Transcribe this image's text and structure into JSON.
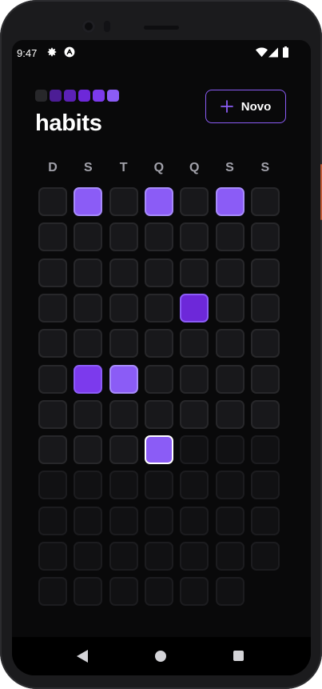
{
  "status_bar": {
    "time": "9:47",
    "icons": [
      "gear-icon",
      "app-notification-icon",
      "wifi-icon",
      "signal-icon",
      "battery-icon"
    ]
  },
  "header": {
    "title": "habits",
    "new_button_label": "Novo",
    "new_button_icon": "plus-icon"
  },
  "summary_levels": [
    0,
    1,
    2,
    3,
    4,
    5
  ],
  "weekdays": [
    "D",
    "S",
    "T",
    "Q",
    "Q",
    "S",
    "S"
  ],
  "colors": {
    "accent": "#8b5cf6",
    "background": "#09090a",
    "cell_empty": "#18181b",
    "level_1": "#4c1d95",
    "level_2": "#5b21b6",
    "level_3": "#6d28d9",
    "level_4": "#7c3aed",
    "level_5": "#8b5cf6"
  },
  "habit_grid": {
    "columns": 7,
    "days": [
      {
        "state": "past",
        "level": 0
      },
      {
        "state": "past",
        "level": 5
      },
      {
        "state": "past",
        "level": 0
      },
      {
        "state": "past",
        "level": 5
      },
      {
        "state": "past",
        "level": 0
      },
      {
        "state": "past",
        "level": 5
      },
      {
        "state": "past",
        "level": 0
      },
      {
        "state": "past",
        "level": 0
      },
      {
        "state": "past",
        "level": 0
      },
      {
        "state": "past",
        "level": 0
      },
      {
        "state": "past",
        "level": 0
      },
      {
        "state": "past",
        "level": 0
      },
      {
        "state": "past",
        "level": 0
      },
      {
        "state": "past",
        "level": 0
      },
      {
        "state": "past",
        "level": 0
      },
      {
        "state": "past",
        "level": 0
      },
      {
        "state": "past",
        "level": 0
      },
      {
        "state": "past",
        "level": 0
      },
      {
        "state": "past",
        "level": 0
      },
      {
        "state": "past",
        "level": 0
      },
      {
        "state": "past",
        "level": 0
      },
      {
        "state": "past",
        "level": 0
      },
      {
        "state": "past",
        "level": 0
      },
      {
        "state": "past",
        "level": 0
      },
      {
        "state": "past",
        "level": 0
      },
      {
        "state": "past",
        "level": 3
      },
      {
        "state": "past",
        "level": 0
      },
      {
        "state": "past",
        "level": 0
      },
      {
        "state": "past",
        "level": 0
      },
      {
        "state": "past",
        "level": 0
      },
      {
        "state": "past",
        "level": 0
      },
      {
        "state": "past",
        "level": 0
      },
      {
        "state": "past",
        "level": 0
      },
      {
        "state": "past",
        "level": 0
      },
      {
        "state": "past",
        "level": 0
      },
      {
        "state": "past",
        "level": 0
      },
      {
        "state": "past",
        "level": 4
      },
      {
        "state": "past",
        "level": 5
      },
      {
        "state": "past",
        "level": 0
      },
      {
        "state": "past",
        "level": 0
      },
      {
        "state": "past",
        "level": 0
      },
      {
        "state": "past",
        "level": 0
      },
      {
        "state": "past",
        "level": 0
      },
      {
        "state": "past",
        "level": 0
      },
      {
        "state": "past",
        "level": 0
      },
      {
        "state": "past",
        "level": 0
      },
      {
        "state": "past",
        "level": 0
      },
      {
        "state": "past",
        "level": 0
      },
      {
        "state": "past",
        "level": 0
      },
      {
        "state": "past",
        "level": 0
      },
      {
        "state": "past",
        "level": 0
      },
      {
        "state": "past",
        "level": 0
      },
      {
        "state": "today",
        "level": 5
      },
      {
        "state": "future",
        "level": 0
      },
      {
        "state": "future",
        "level": 0
      },
      {
        "state": "future",
        "level": 0
      },
      {
        "state": "future",
        "level": 0
      },
      {
        "state": "future",
        "level": 0
      },
      {
        "state": "future",
        "level": 0
      },
      {
        "state": "future",
        "level": 0
      },
      {
        "state": "future",
        "level": 0
      },
      {
        "state": "future",
        "level": 0
      },
      {
        "state": "future",
        "level": 0
      },
      {
        "state": "future",
        "level": 0
      },
      {
        "state": "future",
        "level": 0
      },
      {
        "state": "future",
        "level": 0
      },
      {
        "state": "future",
        "level": 0
      },
      {
        "state": "future",
        "level": 0
      },
      {
        "state": "future",
        "level": 0
      },
      {
        "state": "future",
        "level": 0
      },
      {
        "state": "future",
        "level": 0
      },
      {
        "state": "future",
        "level": 0
      },
      {
        "state": "future",
        "level": 0
      },
      {
        "state": "future",
        "level": 0
      },
      {
        "state": "future",
        "level": 0
      },
      {
        "state": "future",
        "level": 0
      },
      {
        "state": "future",
        "level": 0
      },
      {
        "state": "future",
        "level": 0
      },
      {
        "state": "future",
        "level": 0
      },
      {
        "state": "future",
        "level": 0
      },
      {
        "state": "future",
        "level": 0
      },
      {
        "state": "future",
        "level": 0
      },
      {
        "state": "future",
        "level": 0
      }
    ]
  },
  "nav_bar": {
    "buttons": [
      "back-icon",
      "home-icon",
      "recent-apps-icon"
    ]
  }
}
